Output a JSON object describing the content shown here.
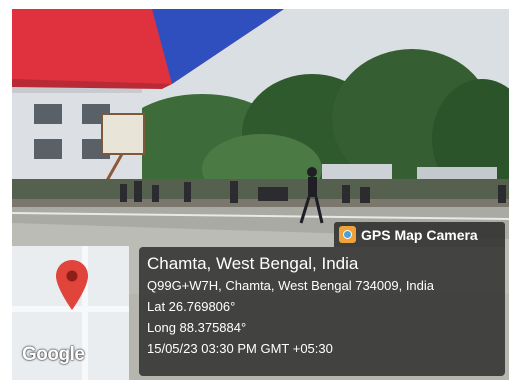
{
  "overlay": {
    "badge_label": "GPS Map Camera",
    "badge_icon": "gps-map-camera-icon",
    "place_title": "Chamta, West Bengal, India",
    "address": "Q99G+W7H, Chamta, West Bengal 734009, India",
    "latitude": "Lat 26.769806°",
    "longitude": "Long 88.375884°",
    "datetime": "15/05/23 03:30 PM GMT +05:30"
  },
  "map": {
    "logo_text": "Google",
    "pin_icon": "map-pin-icon",
    "pin_color": "#e0443a"
  },
  "colors": {
    "panel": "#282828",
    "badge": "#2d2d2d",
    "umbrella_red": "#e0323e",
    "umbrella_blue": "#2f4fbf"
  }
}
